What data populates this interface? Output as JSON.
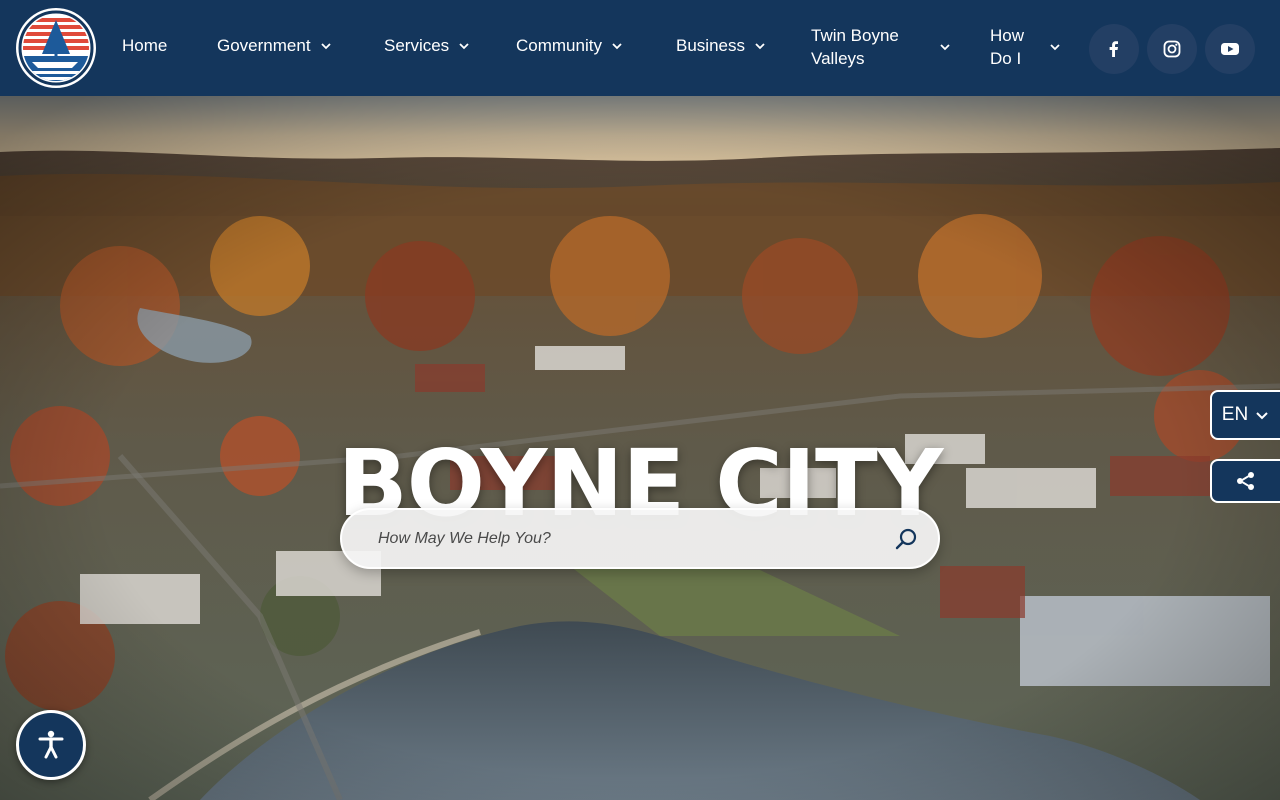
{
  "site": {
    "logo_icon": "boyne-city-logo-icon",
    "colors": {
      "navy": "#14365c",
      "red": "#e04a3a",
      "white": "#ffffff"
    }
  },
  "nav": {
    "items": [
      {
        "label": "Home",
        "has_dropdown": false
      },
      {
        "label": "Government",
        "has_dropdown": true
      },
      {
        "label": "Services",
        "has_dropdown": true
      },
      {
        "label": "Community",
        "has_dropdown": true
      },
      {
        "label": "Business",
        "has_dropdown": true
      },
      {
        "label": "Twin Boyne Valleys",
        "has_dropdown": true
      },
      {
        "label": "How Do I",
        "has_dropdown": true
      }
    ],
    "social": [
      {
        "icon": "facebook-icon"
      },
      {
        "icon": "instagram-icon"
      },
      {
        "icon": "youtube-icon"
      }
    ]
  },
  "hero": {
    "title": "BOYNE CITY",
    "search": {
      "placeholder": "How May We Help You?",
      "value": ""
    }
  },
  "language": {
    "selected": "EN"
  },
  "share": {
    "icon": "share-icon"
  },
  "accessibility": {
    "icon": "accessibility-icon"
  }
}
